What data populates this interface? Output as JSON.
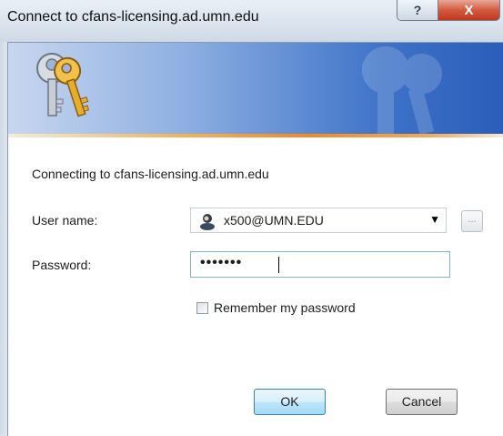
{
  "window": {
    "title": "Connect to cfans-licensing.ad.umn.edu",
    "help_glyph": "?",
    "close_glyph": "X"
  },
  "dialog": {
    "connecting_text": "Connecting to cfans-licensing.ad.umn.edu",
    "username_label": "User name:",
    "username_value": "x500@UMN.EDU",
    "browse_label": "...",
    "password_label": "Password:",
    "password_mask": "•••••••",
    "remember_label": "Remember my password",
    "remember_checked": false,
    "ok_label": "OK",
    "cancel_label": "Cancel"
  },
  "icons": {
    "banner": "keys-icon",
    "watermark": "keys-watermark-icon",
    "user": "user-account-icon",
    "dropdown": "chevron-down-icon"
  },
  "colors": {
    "banner_start": "#c7d7ef",
    "banner_end": "#2a5db9",
    "accent_line": "#f08a22",
    "close_button": "#c0381b",
    "focus_border": "#7fb0e1"
  }
}
